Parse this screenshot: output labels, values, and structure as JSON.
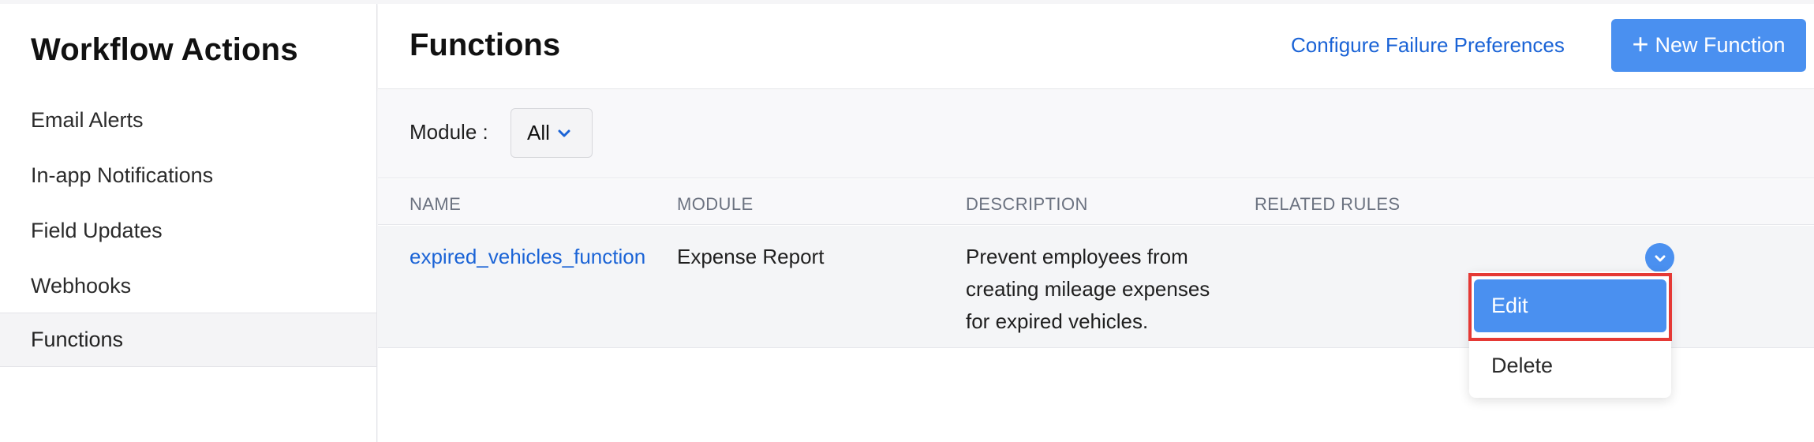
{
  "sidebar": {
    "title": "Workflow Actions",
    "items": [
      {
        "label": "Email Alerts"
      },
      {
        "label": "In-app Notifications"
      },
      {
        "label": "Field Updates"
      },
      {
        "label": "Webhooks"
      },
      {
        "label": "Functions"
      }
    ],
    "active": "Functions"
  },
  "header": {
    "title": "Functions",
    "configure_link": "Configure Failure Preferences",
    "new_button": "New Function"
  },
  "filter": {
    "label": "Module :",
    "selected": "All"
  },
  "table": {
    "columns": [
      "NAME",
      "MODULE",
      "DESCRIPTION",
      "RELATED RULES"
    ],
    "rows": [
      {
        "name": "expired_vehicles_function",
        "module": "Expense Report",
        "description": "Prevent employees from creating mileage expenses for expired vehicles.",
        "related_rules": ""
      }
    ]
  },
  "row_menu": {
    "items": [
      "Edit",
      "Delete"
    ],
    "highlighted": "Edit"
  },
  "colors": {
    "accent": "#4a90f0",
    "link": "#1a63d6",
    "highlight_border": "#e53935"
  }
}
